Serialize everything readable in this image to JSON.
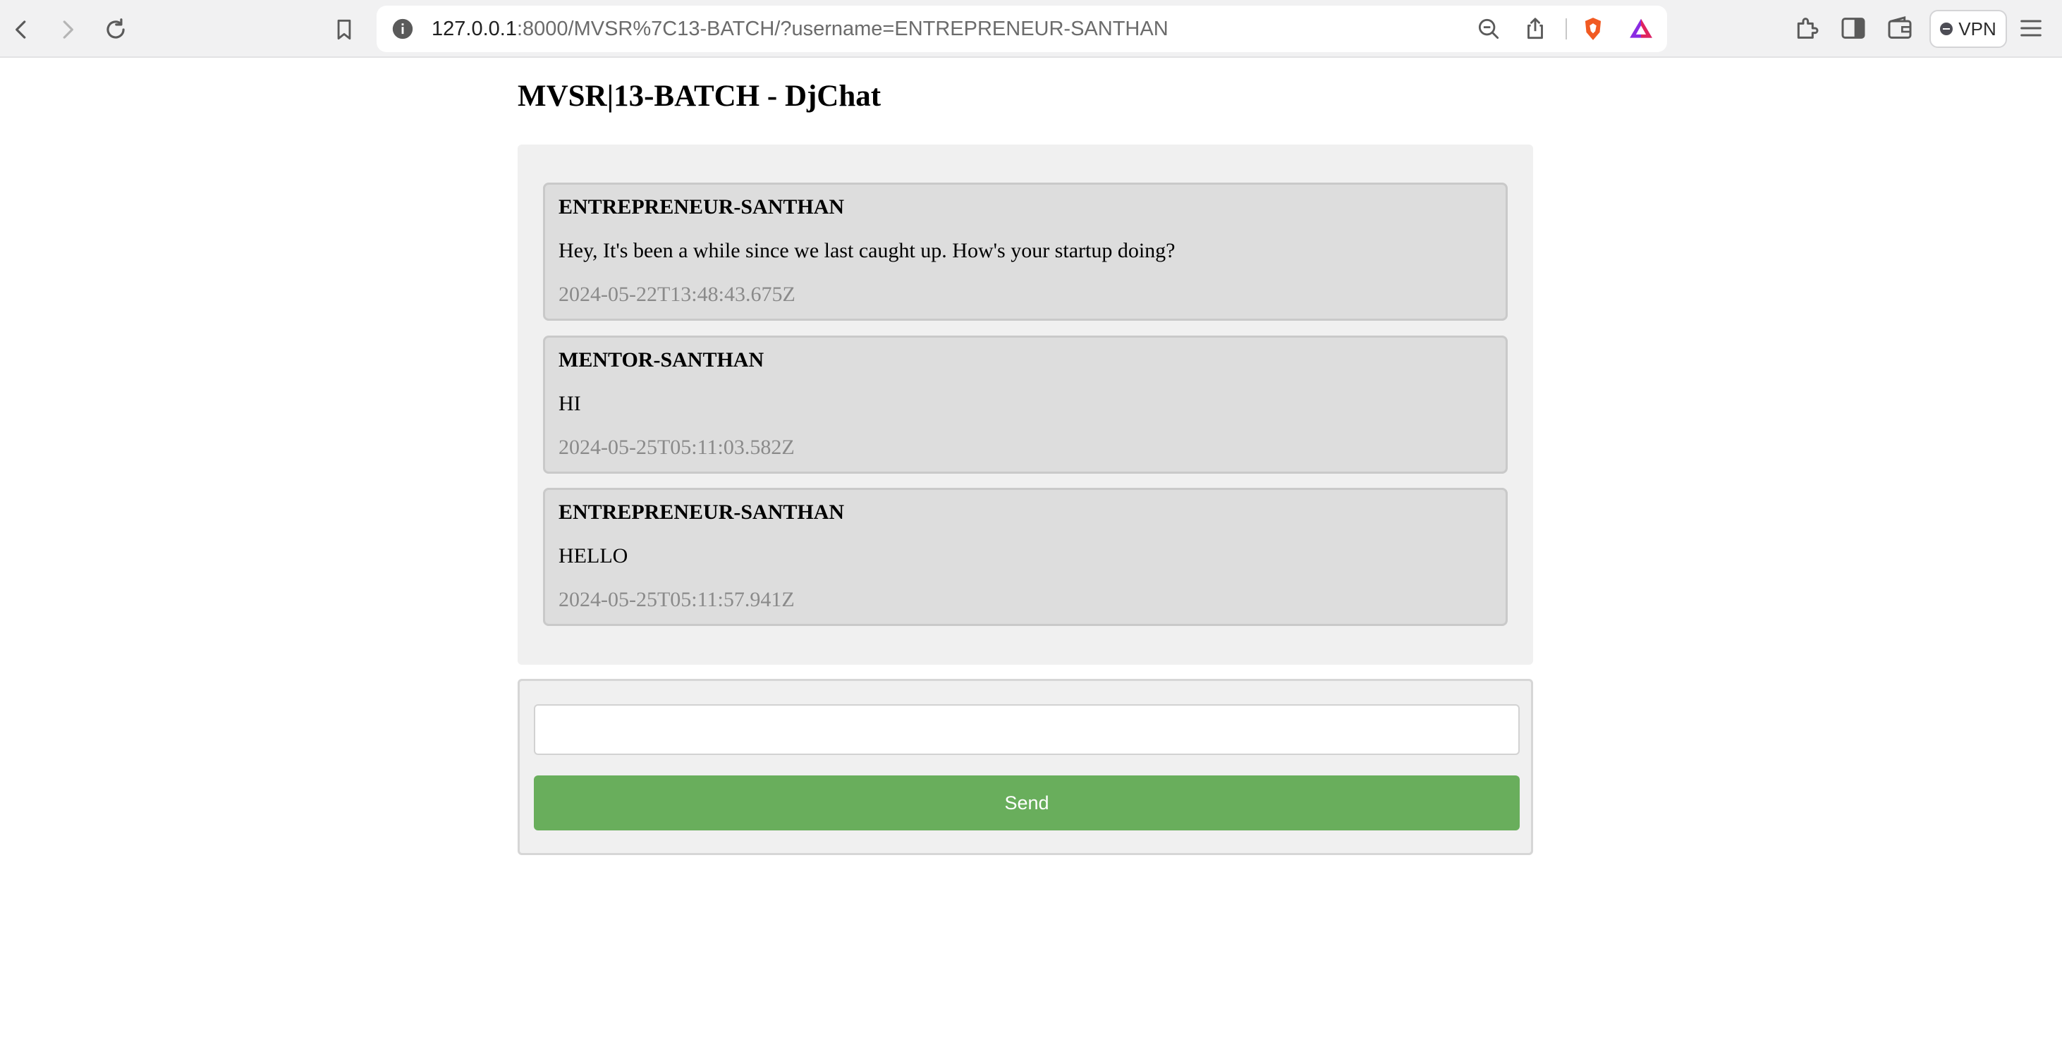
{
  "browser": {
    "url_host": "127.0.0.1",
    "url_rest": ":8000/MVSR%7C13-BATCH/?username=ENTREPRENEUR-SANTHAN",
    "vpn_label": "VPN"
  },
  "page": {
    "title": "MVSR|13-BATCH - DjChat"
  },
  "messages": [
    {
      "user": "ENTREPRENEUR-SANTHAN",
      "text": "Hey, It's been a while since we last caught up. How's your startup doing?",
      "timestamp": "2024-05-22T13:48:43.675Z"
    },
    {
      "user": "MENTOR-SANTHAN",
      "text": "HI",
      "timestamp": "2024-05-25T05:11:03.582Z"
    },
    {
      "user": "ENTREPRENEUR-SANTHAN",
      "text": "HELLO",
      "timestamp": "2024-05-25T05:11:57.941Z"
    }
  ],
  "compose": {
    "input_value": "",
    "send_label": "Send"
  },
  "colors": {
    "send_button": "#69ae5c",
    "message_bg": "#dddddd",
    "container_bg": "#f0f0f0"
  }
}
